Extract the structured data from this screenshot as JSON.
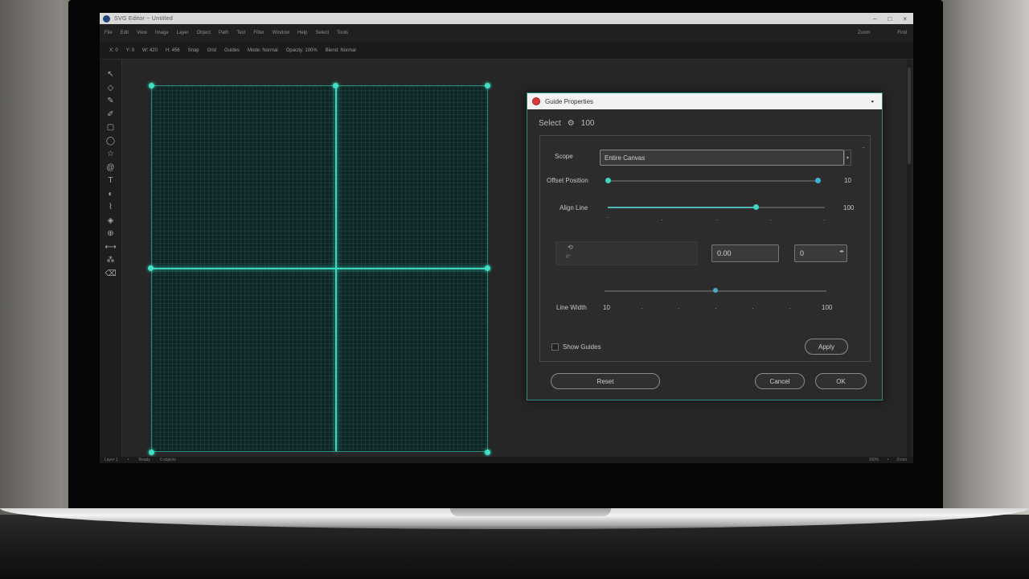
{
  "window": {
    "title": "SVG Editor ~ Untitled",
    "controls": [
      "–",
      "□",
      "×"
    ]
  },
  "menubar": {
    "items": [
      "File",
      "Edit",
      "View",
      "Image",
      "Layer",
      "Object",
      "Path",
      "Text",
      "Filter",
      "Window",
      "Help",
      "Select",
      "Tools"
    ],
    "right_items": [
      "Zoom",
      "Find"
    ]
  },
  "toolbar": {
    "items": [
      "X: 0",
      "Y: 0",
      "W: 420",
      "H: 456",
      "Snap",
      "Grid",
      "Guides",
      "Mode: Normal",
      "Opacity: 100%",
      "Blend: Normal"
    ]
  },
  "left_tools": {
    "icons": [
      "select-icon",
      "node-icon",
      "pen-icon",
      "pencil-icon",
      "rect-icon",
      "ellipse-icon",
      "star-icon",
      "spiral-icon",
      "text-icon",
      "gradient-icon",
      "dropper-icon",
      "fill-icon",
      "zoom-icon",
      "measure-icon",
      "spray-icon",
      "eraser-icon"
    ],
    "glyphs": [
      "↖",
      "◇",
      "✎",
      "✐",
      "▢",
      "◯",
      "☆",
      "@",
      "T",
      "◐",
      "⌇",
      "◈",
      "⊕",
      "⟷",
      "⁂",
      "⌫"
    ]
  },
  "statusbar": {
    "left": [
      "Layer 1",
      "•",
      "Ready",
      "0 objects"
    ],
    "right": [
      "100%",
      "•",
      "Zoom"
    ]
  },
  "dialog": {
    "title": "Guide Properties",
    "heading": "Select",
    "heading_value": "100",
    "scope_label": "Scope",
    "scope_value": "Entire Canvas",
    "offset_label": "Offset Position",
    "offset_value": "10",
    "align_label": "Align Line",
    "align_value": "100",
    "angle_icon_label": "⟲",
    "angle_sub": "0°",
    "x_value": "0.00",
    "y_value": "0",
    "width_label": "Line Width",
    "width_min": "10",
    "width_max": "100",
    "checkbox_label": "Show Guides",
    "apply_label": "Apply",
    "reset_label": "Reset",
    "cancel_label": "Cancel",
    "ok_label": "OK",
    "offset_fraction": 0.0,
    "align_fraction": 0.68,
    "width_fraction": 0.5
  }
}
